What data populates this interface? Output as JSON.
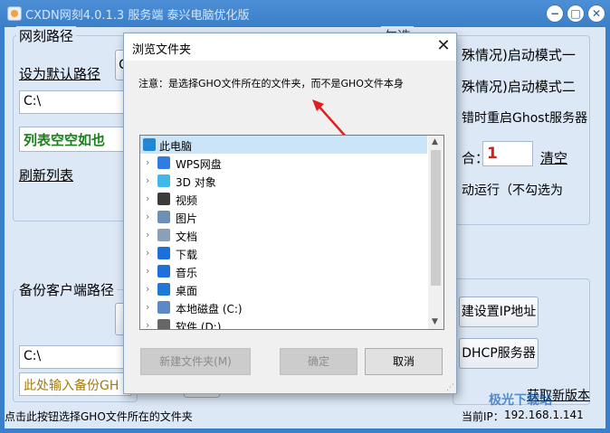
{
  "app": {
    "title": "CXDN网刻4.0.1.3 服务端 泰兴电脑优化版",
    "win_minimize": "−",
    "win_maximize": "□",
    "win_close": "✕"
  },
  "left_panel": {
    "group_title": "网刻路径",
    "default_path_label": "设为默认路径",
    "browse_button_partial": "C",
    "path_value": "C:\\",
    "list_empty_text": "列表空空如也",
    "refresh_list": "刷新列表",
    "backup_group_title": "备份客户端路径",
    "backup_path_value": "C:\\",
    "backup_placeholder": "此处输入备份GH"
  },
  "right_panel": {
    "group_title_partial": "勾选",
    "option1": "殊情况)启动模式一",
    "option2": "殊情况)启动模式二",
    "option3": "错时重启Ghost服务器",
    "count_label_partial": "合：",
    "count_value": "1",
    "clear_link": "清空",
    "autorun_text": "动运行（不勾选为",
    "set_ip_button": "建设置IP地址",
    "dhcp_button": "DHCP服务器",
    "new_version": "获取新版本"
  },
  "status": {
    "hint": "点击此按钮选择GHO文件所在的文件夹",
    "ip_label": "当前IP：",
    "ip_value": "192.168.1.141"
  },
  "dialog": {
    "title": "浏览文件夹",
    "close_glyph": "✕",
    "note": "注意：是选择GHO文件所在的文件夹，而不是GHO文件本身",
    "tree_root": "此电脑",
    "tree_items": [
      {
        "label": "WPS网盘",
        "icon": "cloud-icon",
        "color": "#2f7de1"
      },
      {
        "label": "3D 对象",
        "icon": "cube-icon",
        "color": "#3fb7e8"
      },
      {
        "label": "视频",
        "icon": "film-icon",
        "color": "#3b3b3b"
      },
      {
        "label": "图片",
        "icon": "picture-icon",
        "color": "#6b8fb5"
      },
      {
        "label": "文档",
        "icon": "document-icon",
        "color": "#8aa0b8"
      },
      {
        "label": "下载",
        "icon": "download-arrow-icon",
        "color": "#1e6fd9"
      },
      {
        "label": "音乐",
        "icon": "music-note-icon",
        "color": "#1e6fd9"
      },
      {
        "label": "桌面",
        "icon": "desktop-icon",
        "color": "#1e78d6"
      },
      {
        "label": "本地磁盘 (C:)",
        "icon": "windows-drive-icon",
        "color": "#5a8ac6"
      },
      {
        "label": "软件 (D:)",
        "icon": "drive-icon",
        "color": "#666666"
      }
    ],
    "buttons": {
      "new_folder": "新建文件夹(M)",
      "ok": "确定",
      "cancel": "取消"
    }
  },
  "watermark": "极光下载站",
  "colors": {
    "window_blue": "#3a7fc9",
    "client_bg": "#dce8f6",
    "green_text": "#1a7f1a",
    "red_value": "#d02020",
    "annotation_red": "#e02020"
  }
}
